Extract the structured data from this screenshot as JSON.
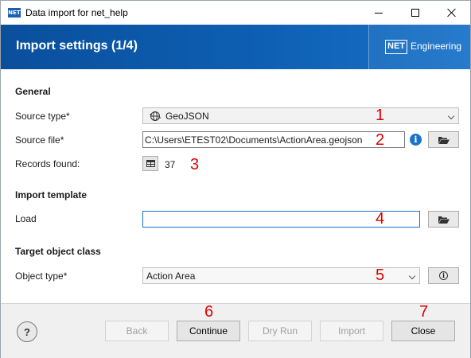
{
  "window": {
    "title": "Data import for net_help",
    "app_icon_text": "NET"
  },
  "banner": {
    "title": "Import settings (1/4)",
    "brand_logo": "NET",
    "brand_text": "Engineering"
  },
  "general": {
    "heading": "General",
    "source_type_label": "Source type*",
    "source_type_value": "GeoJSON",
    "source_file_label": "Source file*",
    "source_file_value": "C:\\Users\\ETEST02\\Documents\\ActionArea.geojson",
    "records_label": "Records found:",
    "records_count": "37"
  },
  "import_template": {
    "heading": "Import template",
    "load_label": "Load",
    "load_value": ""
  },
  "target": {
    "heading": "Target object class",
    "object_type_label": "Object type*",
    "object_type_value": "Action Area"
  },
  "annotations": [
    "1",
    "2",
    "3",
    "4",
    "5",
    "6",
    "7"
  ],
  "footer": {
    "help_label": "?",
    "back_label": "Back",
    "continue_label": "Continue",
    "dry_run_label": "Dry Run",
    "import_label": "Import",
    "close_label": "Close"
  },
  "colors": {
    "banner": "#0d5fb3",
    "annotation": "#e00000",
    "info_icon": "#1a73c9"
  }
}
